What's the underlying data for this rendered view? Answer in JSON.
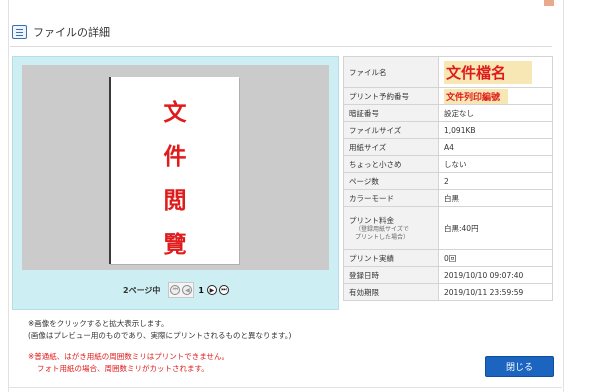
{
  "header": {
    "title": "ファイルの詳細"
  },
  "preview": {
    "doc_chars": [
      "文",
      "件",
      "閲",
      "覽"
    ],
    "pager": {
      "label": "2ページ中",
      "current": "1"
    }
  },
  "details": [
    {
      "key": "ファイル名",
      "value": "文件檔名",
      "style": "hl-big"
    },
    {
      "key": "プリント予約番号",
      "value": "文件列印編號",
      "style": "hl-small"
    },
    {
      "key": "暗証番号",
      "value": "設定なし"
    },
    {
      "key": "ファイルサイズ",
      "value": "1,091KB"
    },
    {
      "key": "用紙サイズ",
      "value": "A4"
    },
    {
      "key": "ちょっと小さめ",
      "value": "しない"
    },
    {
      "key": "ページ数",
      "value": "2"
    },
    {
      "key": "カラーモード",
      "value": "白黒"
    },
    {
      "key": "プリント料金",
      "sub": [
        "（登録用紙サイズで",
        "プリントした場合）"
      ],
      "value": "白黒:40円"
    },
    {
      "key": "プリント実績",
      "value": "0回"
    },
    {
      "key": "登録日時",
      "value": "2019/10/10 09:07:40"
    },
    {
      "key": "有効期限",
      "value": "2019/10/11 23:59:59"
    }
  ],
  "notes": {
    "line1": "※画像をクリックすると拡大表示します。",
    "line2": "(画像はプレビュー用のものであり、実際にプリントされるものと異なります。)",
    "warn1": "※普通紙、はがき用紙の周囲数ミリはプリントできません。",
    "warn2": "フォト用紙の場合、周囲数ミリがカットされます。"
  },
  "buttons": {
    "close": "閉じる"
  },
  "colors": {
    "accent": "#1b65c0",
    "highlight": "#f6e7b4",
    "red": "#e01b1b",
    "preview_bg": "#cdeef3"
  }
}
